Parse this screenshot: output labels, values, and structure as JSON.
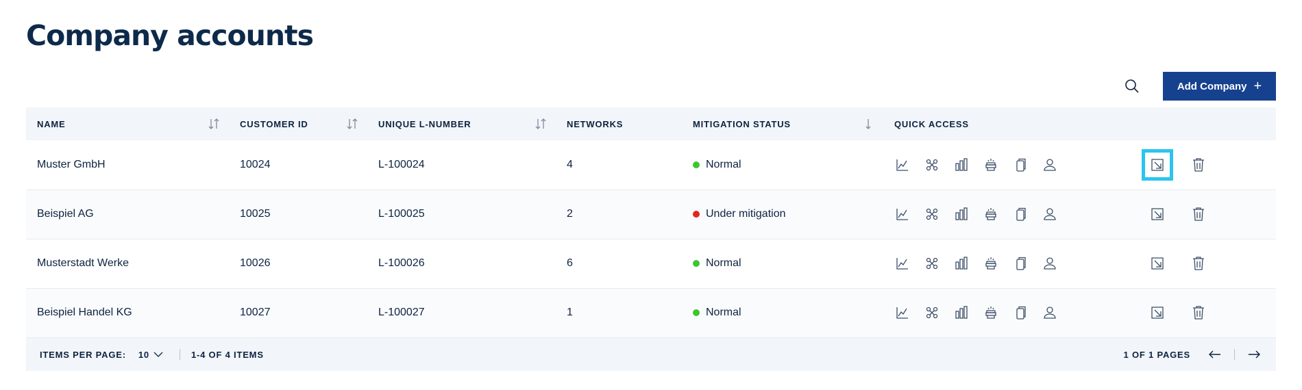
{
  "title": "Company accounts",
  "toolbar": {
    "add_label": "Add Company"
  },
  "table": {
    "headers": {
      "name": "NAME",
      "customer_id": "CUSTOMER ID",
      "l_number": "UNIQUE L-NUMBER",
      "networks": "NETWORKS",
      "mitigation": "MITIGATION STATUS",
      "quick_access": "QUICK ACCESS"
    },
    "rows": [
      {
        "name": "Muster GmbH",
        "customer_id": "10024",
        "l_number": "L-100024",
        "networks": "4",
        "status": "Normal",
        "status_color": "#3cc72a"
      },
      {
        "name": "Beispiel AG",
        "customer_id": "10025",
        "l_number": "L-100025",
        "networks": "2",
        "status": "Under mitigation",
        "status_color": "#e5261a"
      },
      {
        "name": "Musterstadt Werke",
        "customer_id": "10026",
        "l_number": "L-100026",
        "networks": "6",
        "status": "Normal",
        "status_color": "#3cc72a"
      },
      {
        "name": "Beispiel Handel KG",
        "customer_id": "10027",
        "l_number": "L-100027",
        "networks": "1",
        "status": "Normal",
        "status_color": "#3cc72a"
      }
    ],
    "quick_access_icons": [
      "line-chart-icon",
      "network-icon",
      "bar-chart-icon",
      "mitigation-icon",
      "copy-document-icon",
      "user-icon"
    ],
    "action_icons": [
      "open-external-icon",
      "trash-icon"
    ]
  },
  "footer": {
    "items_per_page_label": "ITEMS PER PAGE:",
    "items_per_page_value": "10",
    "items_range": "1-4 OF 4 ITEMS",
    "pages": "1 OF 1 PAGES"
  },
  "colors": {
    "brand": "#16418f",
    "highlight": "#2bc4ef",
    "normal": "#3cc72a",
    "alert": "#e5261a"
  }
}
